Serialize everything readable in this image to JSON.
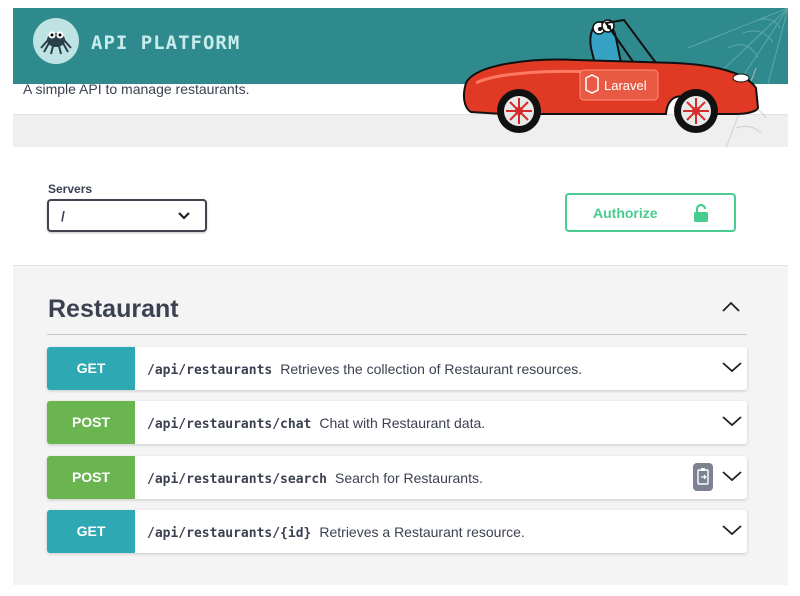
{
  "header": {
    "brand": "API PLATFORM",
    "subtitle": "A simple API to manage restaurants.",
    "car_brand": "Laravel"
  },
  "servers": {
    "label": "Servers",
    "selected": "/"
  },
  "authorize": {
    "label": "Authorize"
  },
  "tag": {
    "title": "Restaurant"
  },
  "operations": [
    {
      "method": "GET",
      "path": "/api/restaurants",
      "summary": "Retrieves the collection of Restaurant resources."
    },
    {
      "method": "POST",
      "path": "/api/restaurants/chat",
      "summary": "Chat with Restaurant data."
    },
    {
      "method": "POST",
      "path": "/api/restaurants/search",
      "summary": "Search for Restaurants."
    },
    {
      "method": "GET",
      "path": "/api/restaurants/{id}",
      "summary": "Retrieves a Restaurant resource."
    }
  ],
  "colors": {
    "header_bg": "#2f8a8e",
    "get": "#2ea8b3",
    "post": "#6ab550",
    "authorize": "#49cc90",
    "car": "#e03a24"
  },
  "icons": {
    "logo": "spider-logo-icon",
    "lock": "lock-icon",
    "chevron": "chevron-down-icon",
    "collapse": "chevron-up-icon",
    "copy": "copy-to-clipboard-icon"
  }
}
